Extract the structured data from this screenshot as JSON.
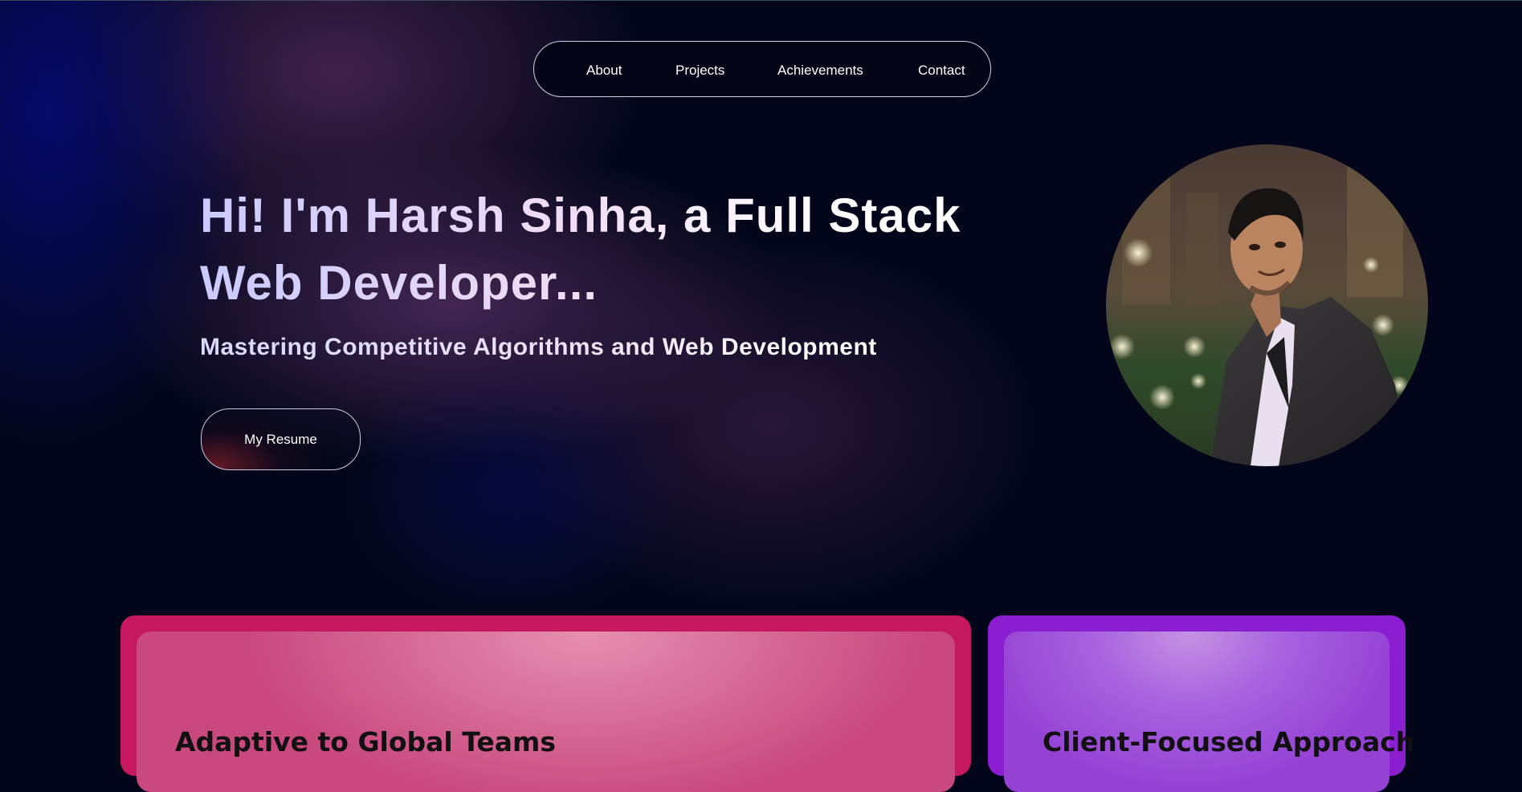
{
  "nav": {
    "items": [
      {
        "label": "About"
      },
      {
        "label": "Projects"
      },
      {
        "label": "Achievements"
      },
      {
        "label": "Contact"
      }
    ]
  },
  "hero": {
    "title_line1": "Hi! I'm Harsh Sinha, a Full Stack",
    "title_line2": "Web Developer...",
    "subtitle": "Mastering Competitive Algorithms and Web Development",
    "resume_label": "My Resume"
  },
  "cards": [
    {
      "title": "Adaptive to Global Teams"
    },
    {
      "title": "Client-Focused Approach"
    }
  ],
  "colors": {
    "background": "#03061a",
    "card_left_border": "#c6185f",
    "card_right_border": "#8a1ed0"
  }
}
